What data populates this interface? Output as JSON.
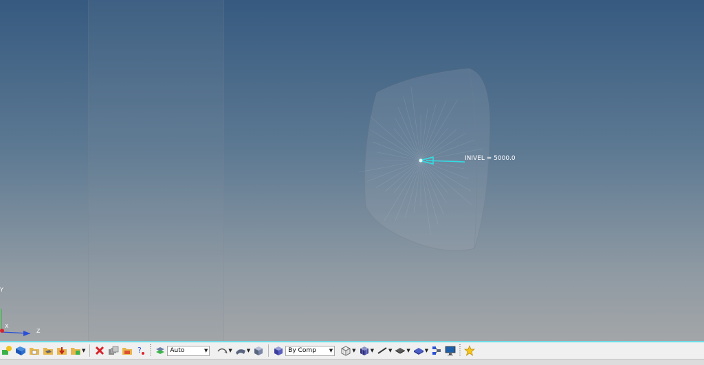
{
  "viewport": {
    "annotation_label": "INIVEL = 5000.0",
    "triad": {
      "y_label": "Y",
      "x_label": "X",
      "z_label": "Z"
    }
  },
  "toolbar": {
    "display_mode_value": "Auto",
    "color_mode_value": "By Comp",
    "colors": {
      "accent": "#6fdde8",
      "arrow": "#2ee0e6",
      "background_top": "#365a80",
      "background_bottom": "#a3a6a8"
    }
  }
}
